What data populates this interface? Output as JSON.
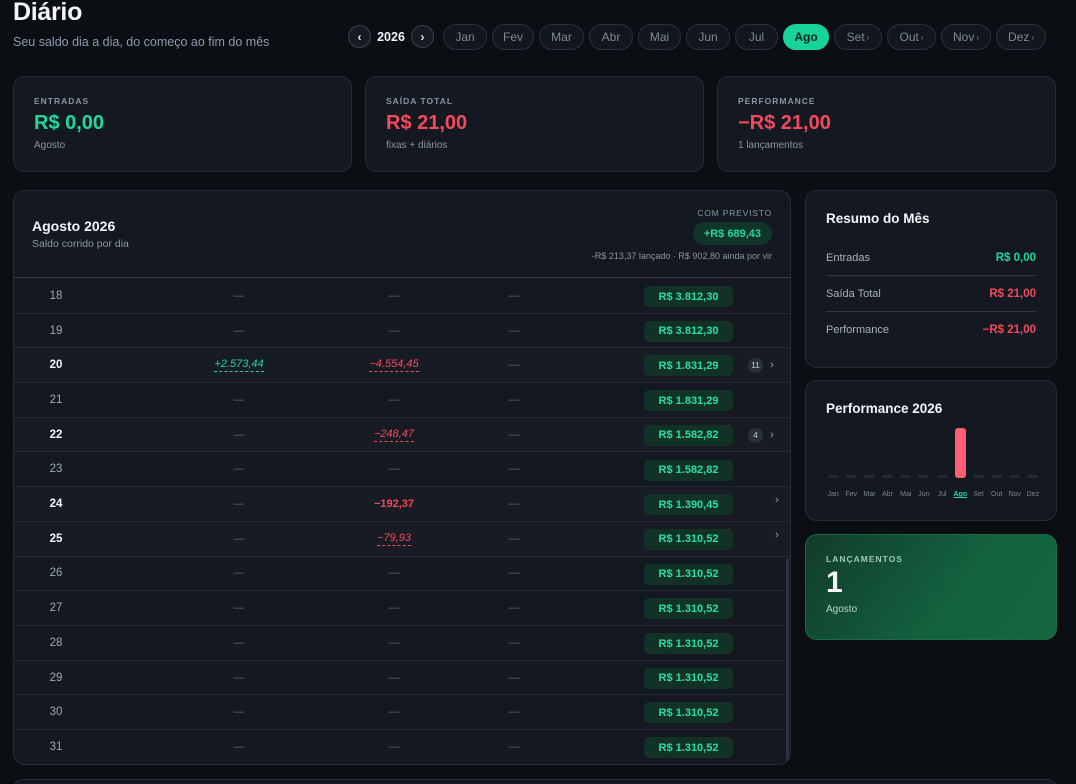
{
  "header": {
    "title": "Diário",
    "subtitle": "Seu saldo dia a dia, do começo ao fim do mês",
    "year": "2026",
    "months": [
      {
        "label": "Jan",
        "chevron": ""
      },
      {
        "label": "Fev",
        "chevron": ""
      },
      {
        "label": "Mar",
        "chevron": ""
      },
      {
        "label": "Abr",
        "chevron": ""
      },
      {
        "label": "Mai",
        "chevron": ""
      },
      {
        "label": "Jun",
        "chevron": ""
      },
      {
        "label": "Jul",
        "chevron": ""
      },
      {
        "label": "Ago",
        "chevron": ""
      },
      {
        "label": "Set",
        "chevron": "›"
      },
      {
        "label": "Out",
        "chevron": "›"
      },
      {
        "label": "Nov",
        "chevron": "›"
      },
      {
        "label": "Dez",
        "chevron": "›"
      }
    ],
    "active_month": "Ago"
  },
  "stats": [
    {
      "label": "ENTRADAS",
      "value": "R$ 0,00",
      "sub": "Agosto",
      "color": "#1fd99b"
    },
    {
      "label": "SAÍDA TOTAL",
      "value": "R$ 21,00",
      "sub": "fixas + diários",
      "color": "#f2495f"
    },
    {
      "label": "PERFORMANCE",
      "value": "−R$ 21,00",
      "sub": "1 lançamentos",
      "color": "#f2495f"
    }
  ],
  "daily": {
    "title": "Agosto 2026",
    "subtitle": "Saldo corrido por dia",
    "forecast_label": "COM PREVISTO",
    "forecast_value": "+R$ 689,43",
    "forecast_note": "-R$ 213,37 lançado · R$ 902,80 ainda por vir",
    "rows": [
      {
        "day": "18",
        "c1": "—",
        "c2": "—",
        "c3": "—",
        "balance": "R$ 3.812,30",
        "badge": "",
        "arrow": "",
        "hl": false
      },
      {
        "day": "19",
        "c1": "—",
        "c2": "—",
        "c3": "—",
        "balance": "R$ 3.812,30",
        "badge": "",
        "arrow": "",
        "hl": false
      },
      {
        "day": "20",
        "c1": "+2.573,44",
        "c2": "−4.554,45",
        "c3": "—",
        "balance": "R$ 1.831,29",
        "badge": "11",
        "arrow": "›",
        "hl": true
      },
      {
        "day": "21",
        "c1": "—",
        "c2": "—",
        "c3": "—",
        "balance": "R$ 1.831,29",
        "badge": "",
        "arrow": "",
        "hl": false
      },
      {
        "day": "22",
        "c1": "—",
        "c2": "−248,47",
        "c3": "—",
        "balance": "R$ 1.582,82",
        "badge": "4",
        "arrow": "›",
        "hl": true
      },
      {
        "day": "23",
        "c1": "—",
        "c2": "—",
        "c3": "—",
        "balance": "R$ 1.582,82",
        "badge": "",
        "arrow": "",
        "hl": false
      },
      {
        "day": "24",
        "c1": "—",
        "c2": "−192,37",
        "c3": "—",
        "balance": "R$ 1.390,45",
        "badge": "",
        "arrow": "›",
        "hl": true
      },
      {
        "day": "25",
        "c1": "—",
        "c2": "−79,93",
        "c3": "—",
        "balance": "R$ 1.310,52",
        "badge": "",
        "arrow": "›",
        "hl": true
      },
      {
        "day": "26",
        "c1": "—",
        "c2": "—",
        "c3": "—",
        "balance": "R$ 1.310,52",
        "badge": "",
        "arrow": "",
        "hl": false
      },
      {
        "day": "27",
        "c1": "—",
        "c2": "—",
        "c3": "—",
        "balance": "R$ 1.310,52",
        "badge": "",
        "arrow": "",
        "hl": false
      },
      {
        "day": "28",
        "c1": "—",
        "c2": "—",
        "c3": "—",
        "balance": "R$ 1.310,52",
        "badge": "",
        "arrow": "",
        "hl": false
      },
      {
        "day": "29",
        "c1": "—",
        "c2": "—",
        "c3": "—",
        "balance": "R$ 1.310,52",
        "badge": "",
        "arrow": "",
        "hl": false
      },
      {
        "day": "30",
        "c1": "—",
        "c2": "—",
        "c3": "—",
        "balance": "R$ 1.310,52",
        "badge": "",
        "arrow": "",
        "hl": false
      },
      {
        "day": "31",
        "c1": "—",
        "c2": "—",
        "c3": "—",
        "balance": "R$ 1.310,52",
        "badge": "",
        "arrow": "",
        "hl": false
      }
    ]
  },
  "resumo": {
    "title": "Resumo do Mês",
    "lines": [
      {
        "label": "Entradas",
        "value": "R$ 0,00",
        "color": "#1fd99b"
      },
      {
        "label": "Saída Total",
        "value": "R$ 21,00",
        "color": "#f2495f"
      },
      {
        "label": "Performance",
        "value": "−R$ 21,00",
        "color": "#f2495f"
      }
    ]
  },
  "performance": {
    "title": "Performance 2026",
    "months": [
      "Jan",
      "Fev",
      "Mar",
      "Abr",
      "Mai",
      "Jun",
      "Jul",
      "Ago",
      "Set",
      "Out",
      "Nov",
      "Dez"
    ],
    "values": [
      0,
      0,
      0,
      0,
      0,
      0,
      0,
      -21,
      0,
      0,
      0,
      0
    ],
    "active": "Ago"
  },
  "lancamentos": {
    "label": "LANÇAMENTOS",
    "count": "1",
    "sub": "Agosto"
  },
  "colors": {
    "positive": "#1fd99b",
    "negative": "#f2495f",
    "accent": "#17d49b"
  }
}
